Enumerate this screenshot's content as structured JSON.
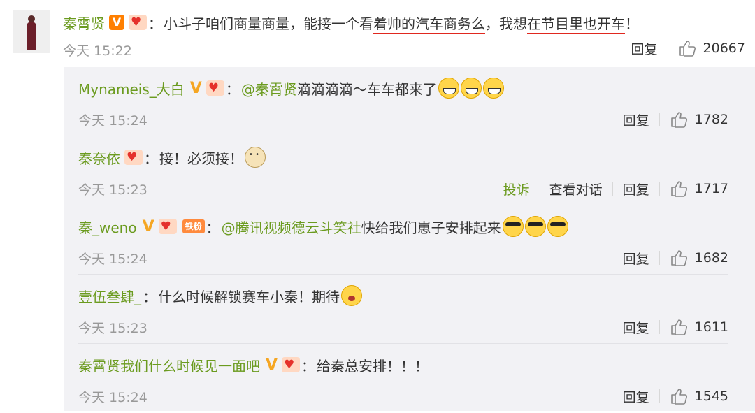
{
  "main": {
    "user": "秦霄贤",
    "colon": "：",
    "text_before": "小斗子咱们商量商量，能接一个看",
    "text_underlined1": "着帅的汽车商务么",
    "text_middle": "，我想",
    "text_underlined2": "在节目里也开车",
    "text_end": "！",
    "time": "今天 15:22",
    "reply_label": "回复",
    "likes": "20667"
  },
  "replies": [
    {
      "user": "Mynameis_大白",
      "colon": "：",
      "mention": "@秦霄贤",
      "text": " 滴滴滴滴～车车都来了",
      "time": "今天 15:24",
      "reply_label": "回复",
      "likes": "1782"
    },
    {
      "user": "秦奈依",
      "colon": "：",
      "text": "接！必须接！",
      "time": "今天 15:23",
      "report_label": "投诉",
      "conversation_label": "查看对话",
      "reply_label": "回复",
      "likes": "1717"
    },
    {
      "user": "秦_weno",
      "fan_badge": "铁粉",
      "colon": "：",
      "mention": "@腾讯视频德云斗笑社",
      "text": " 快给我们崽子安排起来",
      "time": "今天 15:24",
      "reply_label": "回复",
      "likes": "1682"
    },
    {
      "user": "壹伍叁肆_",
      "colon": "：",
      "text": "什么时候解锁赛车小秦！期待",
      "time": "今天 15:23",
      "reply_label": "回复",
      "likes": "1611"
    },
    {
      "user": "秦霄贤我们什么时候见一面吧",
      "colon": "：",
      "text": "给秦总安排！！！",
      "time": "今天 15:24",
      "reply_label": "回复",
      "likes": "1545"
    }
  ],
  "icons": {
    "verified": "verified-badge-icon",
    "gold_v": "gold-v-icon",
    "heart": "heart-badge-icon",
    "thumb": "thumb-up-icon"
  },
  "colors": {
    "username": "#6b9b1f",
    "timestamp": "#999999",
    "underline": "#e0281f",
    "panel": "#f2f2f5"
  }
}
